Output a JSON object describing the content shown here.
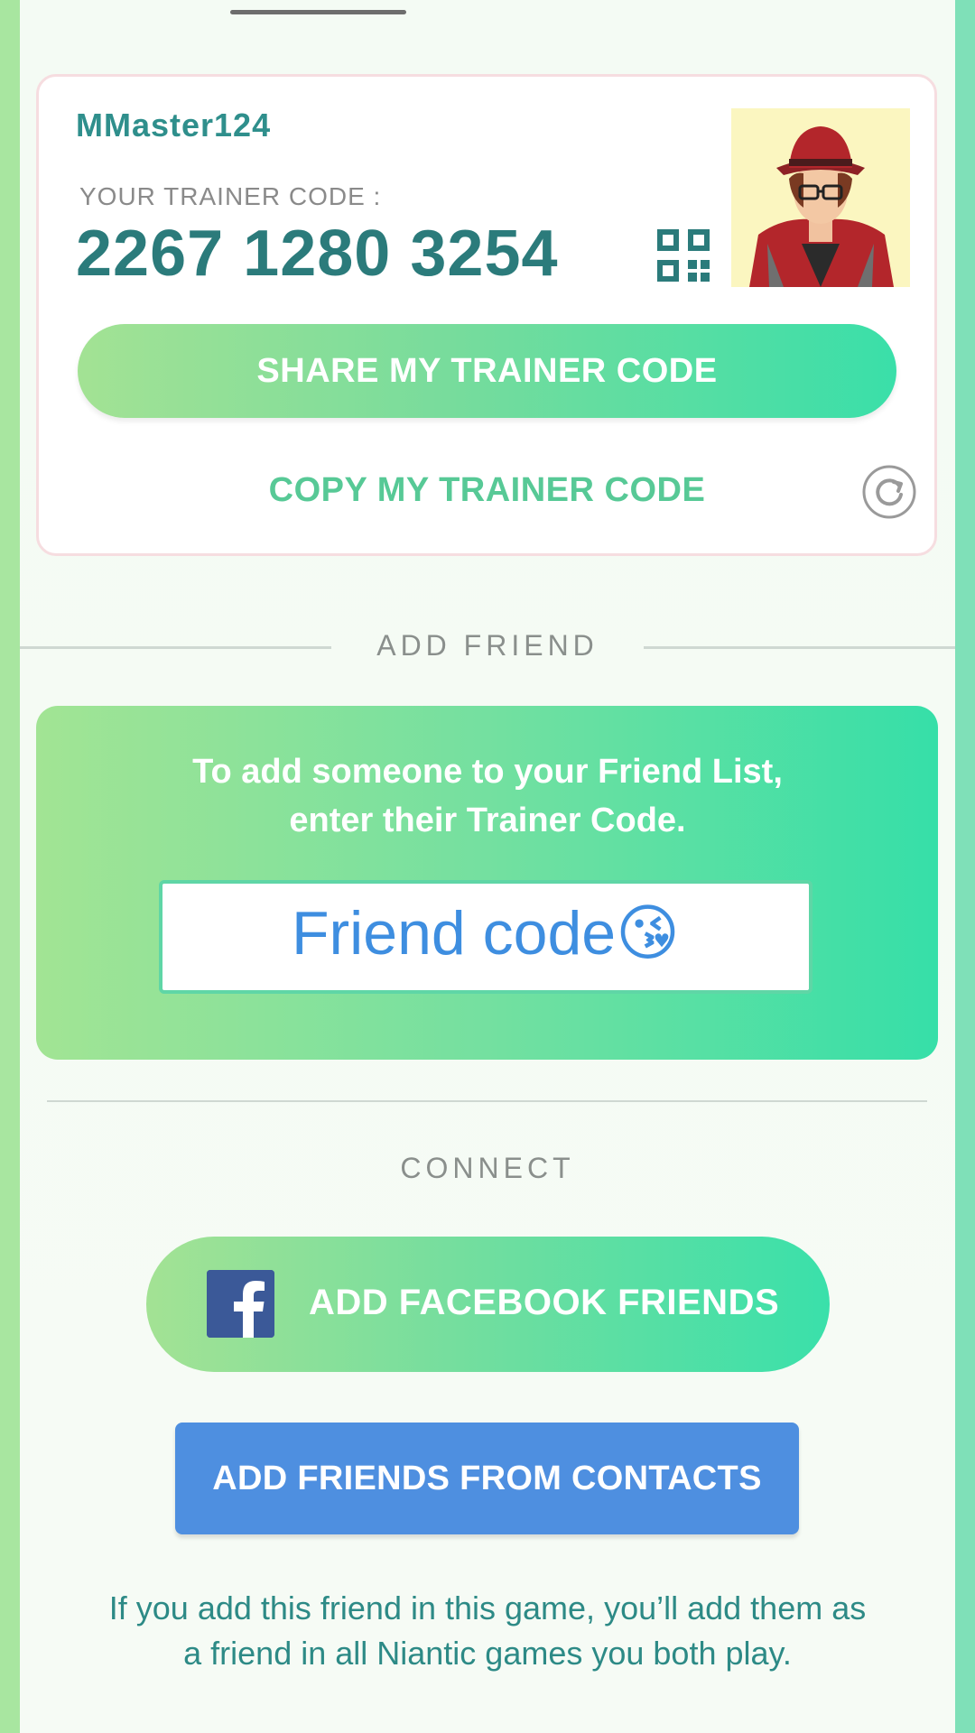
{
  "trainer": {
    "username": "MMaster124",
    "code_label": "YOUR TRAINER CODE :",
    "code": "2267 1280 3254"
  },
  "buttons": {
    "share": "SHARE MY TRAINER CODE",
    "copy": "COPY MY TRAINER CODE",
    "facebook": "ADD FACEBOOK FRIENDS",
    "contacts": "ADD FRIENDS FROM CONTACTS"
  },
  "add_friend": {
    "section_title": "ADD FRIEND",
    "instructions": "To add someone to your Friend List, enter their Trainer Code.",
    "input_value": "",
    "overlay_caption": "Friend code😘"
  },
  "connect": {
    "section_title": "CONNECT"
  },
  "footer_note": "If you add this friend in this game, you’ll add them as a friend in all Niantic games you both play.",
  "icons": {
    "qr": "qr-code-icon",
    "refresh": "refresh-icon",
    "facebook": "facebook-icon"
  },
  "colors": {
    "teal_text": "#2b7b7b",
    "green_start": "#a3e294",
    "green_end": "#3adfa9",
    "blue_button": "#4e8fe0",
    "facebook_blue": "#3b5998"
  }
}
